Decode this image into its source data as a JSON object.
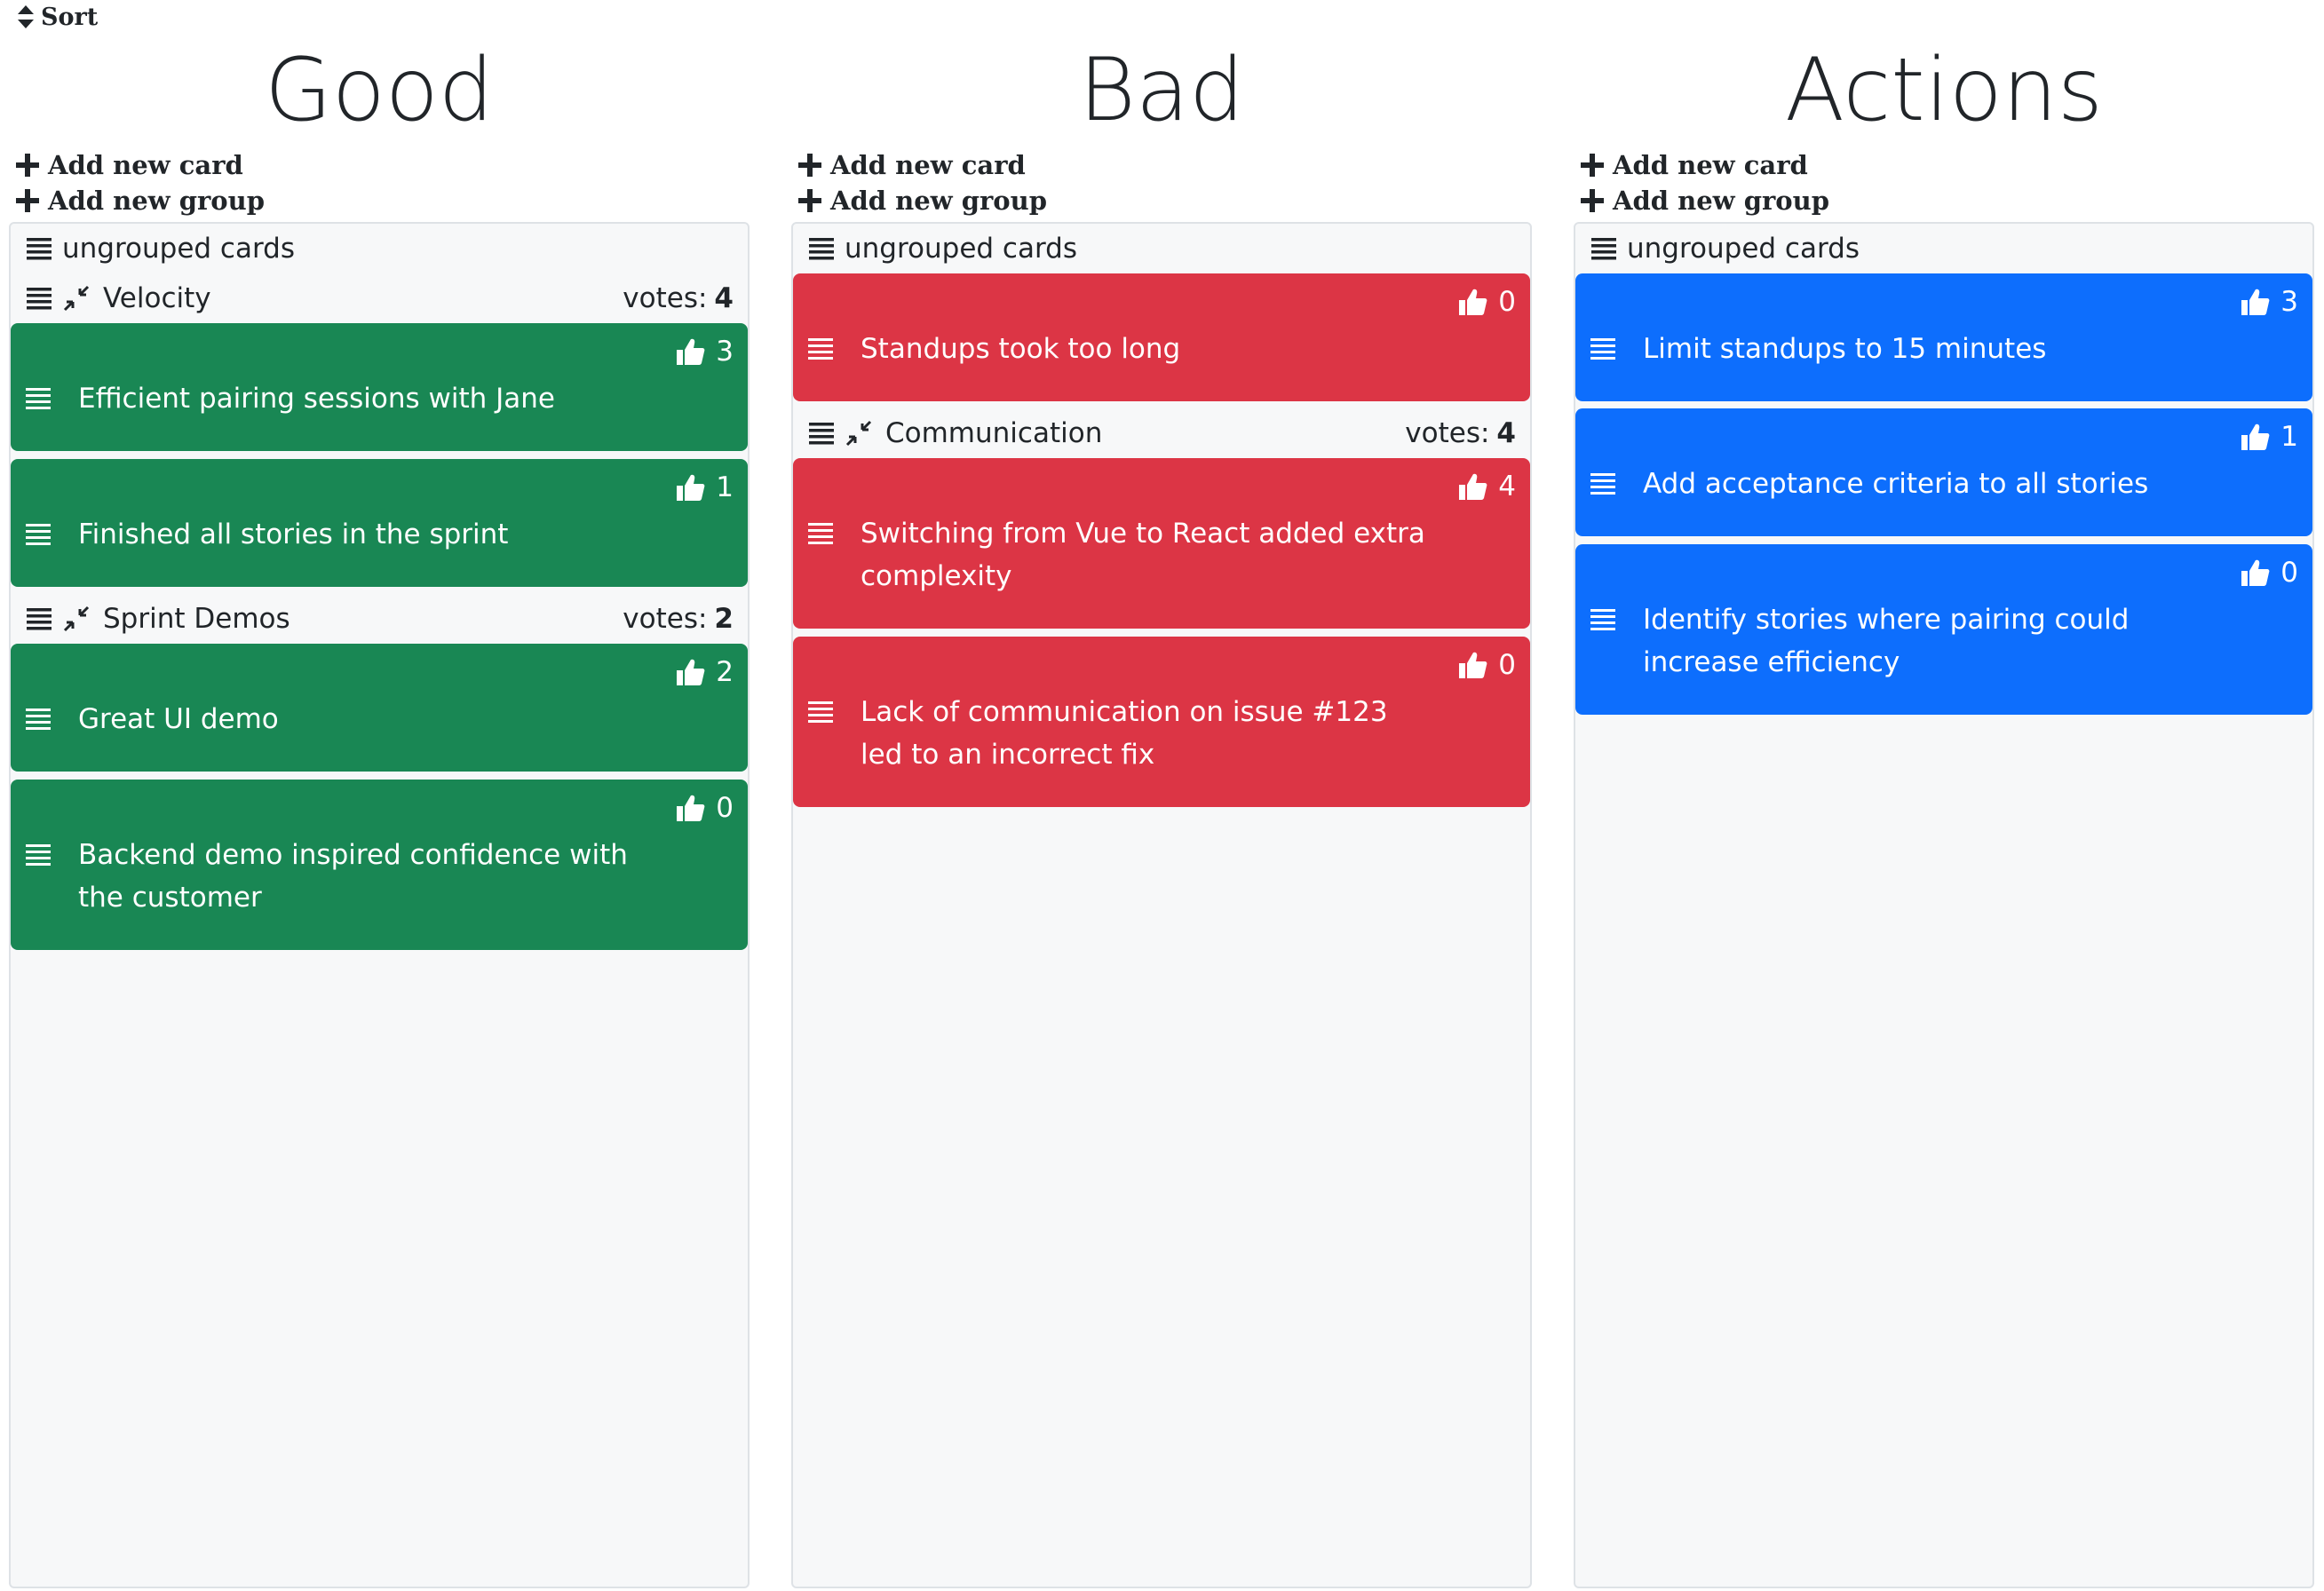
{
  "sort_label": "Sort",
  "add_card_label": "Add new card",
  "add_group_label": "Add new group",
  "ungrouped_label": "ungrouped cards",
  "votes_label": "votes:",
  "columns": [
    {
      "title": "Good",
      "ungrouped": [],
      "groups": [
        {
          "name": "Velocity",
          "votes": "4",
          "cards": [
            {
              "text": "Efficient pairing sessions with Jane",
              "votes": "3"
            },
            {
              "text": "Finished all stories in the sprint",
              "votes": "1"
            }
          ]
        },
        {
          "name": "Sprint Demos",
          "votes": "2",
          "cards": [
            {
              "text": "Great UI demo",
              "votes": "2"
            },
            {
              "text": "Backend demo inspired confidence with the customer",
              "votes": "0"
            }
          ]
        }
      ]
    },
    {
      "title": "Bad",
      "ungrouped": [
        {
          "text": "Standups took too long",
          "votes": "0"
        }
      ],
      "groups": [
        {
          "name": "Communication",
          "votes": "4",
          "cards": [
            {
              "text": "Switching from Vue to React added extra complexity",
              "votes": "4"
            },
            {
              "text": "Lack of communication on issue #123 led to an incorrect fix",
              "votes": "0"
            }
          ]
        }
      ]
    },
    {
      "title": "Actions",
      "ungrouped": [
        {
          "text": "Limit standups to 15 minutes",
          "votes": "3"
        },
        {
          "text": "Add acceptance criteria to all stories",
          "votes": "1"
        },
        {
          "text": "Identify stories where pairing could increase efficiency",
          "votes": "0"
        }
      ],
      "groups": []
    }
  ],
  "colors": {
    "good": "#198754",
    "bad": "#dc3545",
    "actions": "#0d6efd"
  },
  "icons": {
    "sort": "sort-icon",
    "add": "plus-icon",
    "drag": "drag-handle-icon",
    "collapse": "compress-icon",
    "vote": "thumbs-up-icon"
  }
}
